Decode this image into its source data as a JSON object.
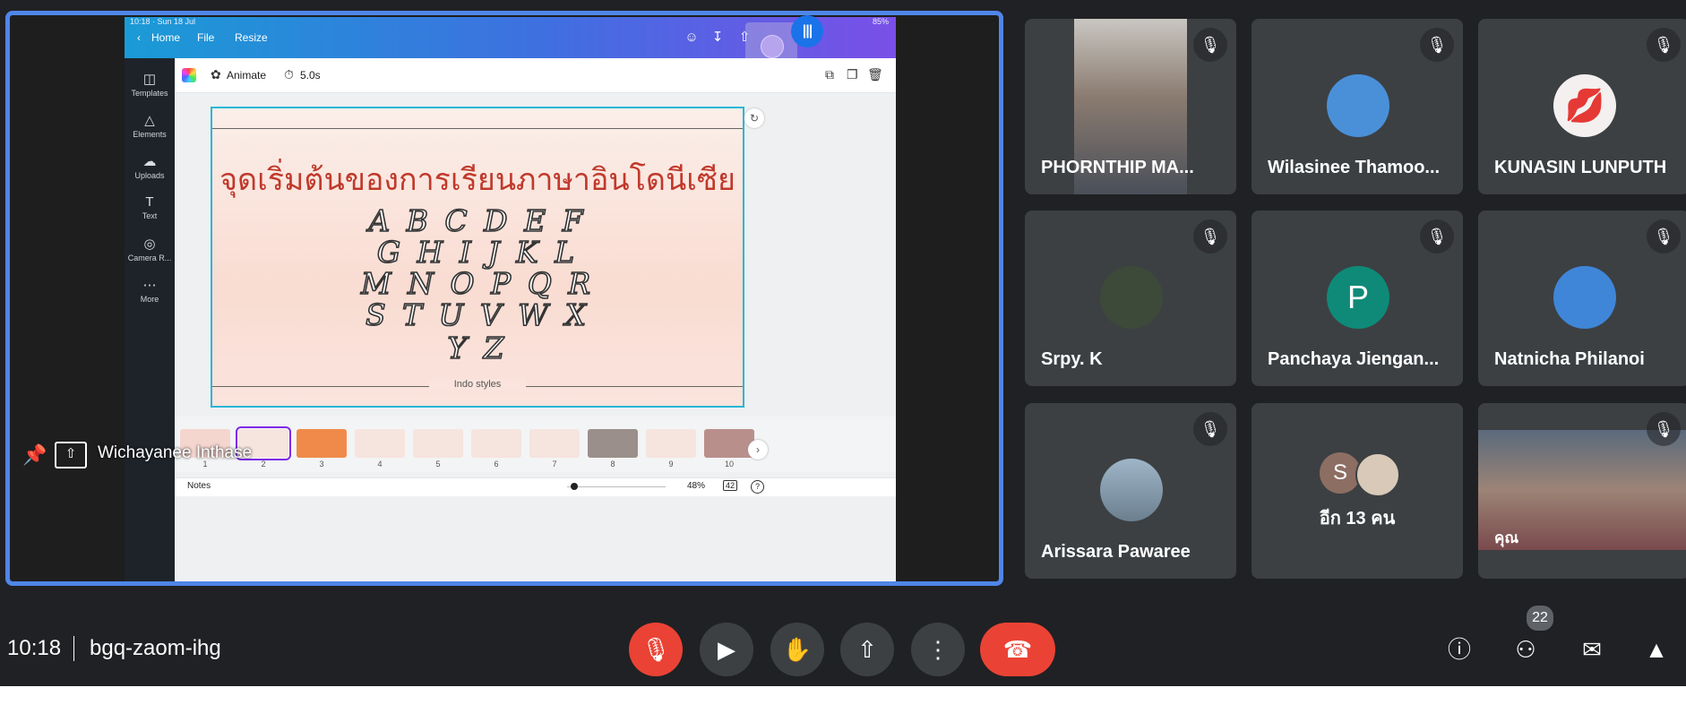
{
  "presenter": {
    "name": "Wichayanee Inthase",
    "status_time": "10:18 · Sun 18 Jul",
    "status_battery": "85%",
    "nav": {
      "home": "Home",
      "file": "File",
      "resize": "Resize"
    },
    "sidebar": [
      {
        "icon": "templates-icon",
        "label": "Templates"
      },
      {
        "icon": "elements-icon",
        "label": "Elements"
      },
      {
        "icon": "uploads-icon",
        "label": "Uploads"
      },
      {
        "icon": "text-icon",
        "label": "Text"
      },
      {
        "icon": "camera-roll-icon",
        "label": "Camera R..."
      },
      {
        "icon": "more-icon",
        "label": "More"
      }
    ],
    "toolbar": {
      "animate": "Animate",
      "duration": "5.0s"
    },
    "slide": {
      "title": "จุดเริ่มต้นของการเรียนภาษาอินโดนีเซีย",
      "alphabet_rows": [
        "A B C D E F",
        "G H I J K L",
        "M N O P Q R",
        "S T U V W X",
        "Y Z"
      ],
      "footer": "Indo styles"
    },
    "thumbnails": [
      "1",
      "2",
      "3",
      "4",
      "5",
      "6",
      "7",
      "8",
      "9",
      "10"
    ],
    "selected_thumbnail": "2",
    "notes_label": "Notes",
    "zoom": "48%",
    "page_count": "42",
    "help": "?"
  },
  "participants": [
    {
      "name": "PHORNTHIP MA...",
      "type": "video",
      "muted": true
    },
    {
      "name": "Wilasinee Thamoo...",
      "type": "avatar",
      "muted": true
    },
    {
      "name": "KUNASIN LUNPUTH",
      "type": "avatar",
      "muted": true
    },
    {
      "name": "Srpy. K",
      "type": "avatar",
      "muted": true
    },
    {
      "name": "Panchaya Jiengan...",
      "type": "letter",
      "letter": "P",
      "muted": true
    },
    {
      "name": "Natnicha Philanoi",
      "type": "avatar",
      "muted": true
    },
    {
      "name": "Arissara Pawaree",
      "type": "avatar",
      "muted": true
    },
    {
      "name": "อีก 13 คน",
      "type": "group",
      "letter": "S",
      "muted": false
    },
    {
      "name": "คุณ",
      "type": "video",
      "muted": true
    }
  ],
  "bottom_bar": {
    "time": "10:18",
    "meeting_code": "bgq-zaom-ihg",
    "people_count": "22"
  },
  "colors": {
    "meet_bg": "#202124",
    "tile_bg": "#3c4043",
    "red": "#ea4335",
    "blue": "#1a73e8",
    "present_border": "#4f86e8"
  }
}
